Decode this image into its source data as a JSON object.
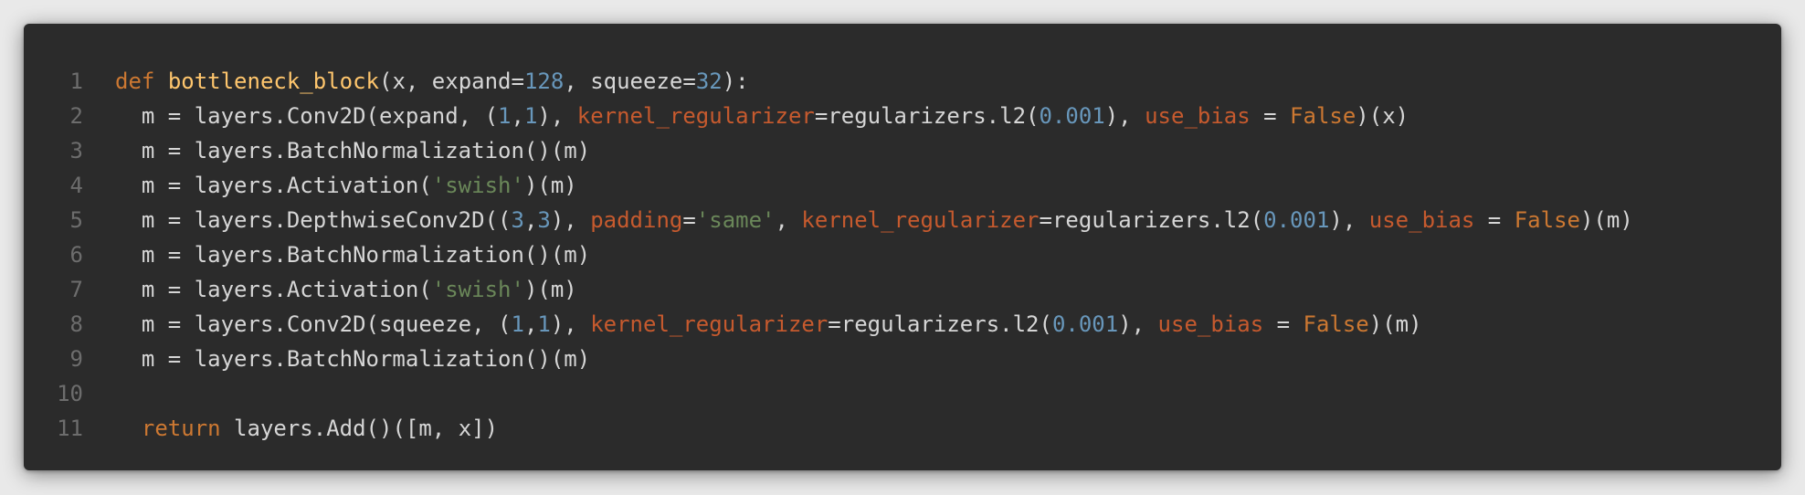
{
  "colors": {
    "background": "#2b2b2b",
    "page": "#e9e9e9",
    "line_number": "#6d6d6d",
    "plain": "#d6d6d6",
    "keyword": "#cc7832",
    "function_name": "#ffc66d",
    "number": "#6897bb",
    "string": "#6a8759",
    "keyword_argument": "#c65a2e"
  },
  "lines": [
    {
      "number": "1",
      "tokens": [
        {
          "t": "def",
          "c": "kw"
        },
        {
          "t": " ",
          "c": "pl"
        },
        {
          "t": "bottleneck_block",
          "c": "fn"
        },
        {
          "t": "(x, expand=",
          "c": "pl"
        },
        {
          "t": "128",
          "c": "num"
        },
        {
          "t": ", squeeze=",
          "c": "pl"
        },
        {
          "t": "32",
          "c": "num"
        },
        {
          "t": "):",
          "c": "pl"
        }
      ]
    },
    {
      "number": "2",
      "tokens": [
        {
          "t": "  m = layers.Conv2D(expand, (",
          "c": "pl"
        },
        {
          "t": "1",
          "c": "num"
        },
        {
          "t": ",",
          "c": "pl"
        },
        {
          "t": "1",
          "c": "num"
        },
        {
          "t": "), ",
          "c": "pl"
        },
        {
          "t": "kernel_regularizer",
          "c": "kwa"
        },
        {
          "t": "=regularizers.l2(",
          "c": "pl"
        },
        {
          "t": "0.001",
          "c": "num"
        },
        {
          "t": "), ",
          "c": "pl"
        },
        {
          "t": "use_bias",
          "c": "kwa"
        },
        {
          "t": " = ",
          "c": "pl"
        },
        {
          "t": "False",
          "c": "kw"
        },
        {
          "t": ")(x)",
          "c": "pl"
        }
      ]
    },
    {
      "number": "3",
      "tokens": [
        {
          "t": "  m = layers.BatchNormalization()(m)",
          "c": "pl"
        }
      ]
    },
    {
      "number": "4",
      "tokens": [
        {
          "t": "  m = layers.Activation(",
          "c": "pl"
        },
        {
          "t": "'swish'",
          "c": "str"
        },
        {
          "t": ")(m)",
          "c": "pl"
        }
      ]
    },
    {
      "number": "5",
      "tokens": [
        {
          "t": "  m = layers.DepthwiseConv2D((",
          "c": "pl"
        },
        {
          "t": "3",
          "c": "num"
        },
        {
          "t": ",",
          "c": "pl"
        },
        {
          "t": "3",
          "c": "num"
        },
        {
          "t": "), ",
          "c": "pl"
        },
        {
          "t": "padding",
          "c": "kwa"
        },
        {
          "t": "=",
          "c": "pl"
        },
        {
          "t": "'same'",
          "c": "str"
        },
        {
          "t": ", ",
          "c": "pl"
        },
        {
          "t": "kernel_regularizer",
          "c": "kwa"
        },
        {
          "t": "=regularizers.l2(",
          "c": "pl"
        },
        {
          "t": "0.001",
          "c": "num"
        },
        {
          "t": "), ",
          "c": "pl"
        },
        {
          "t": "use_bias",
          "c": "kwa"
        },
        {
          "t": " = ",
          "c": "pl"
        },
        {
          "t": "False",
          "c": "kw"
        },
        {
          "t": ")(m)",
          "c": "pl"
        }
      ]
    },
    {
      "number": "6",
      "tokens": [
        {
          "t": "  m = layers.BatchNormalization()(m)",
          "c": "pl"
        }
      ]
    },
    {
      "number": "7",
      "tokens": [
        {
          "t": "  m = layers.Activation(",
          "c": "pl"
        },
        {
          "t": "'swish'",
          "c": "str"
        },
        {
          "t": ")(m)",
          "c": "pl"
        }
      ]
    },
    {
      "number": "8",
      "tokens": [
        {
          "t": "  m = layers.Conv2D(squeeze, (",
          "c": "pl"
        },
        {
          "t": "1",
          "c": "num"
        },
        {
          "t": ",",
          "c": "pl"
        },
        {
          "t": "1",
          "c": "num"
        },
        {
          "t": "), ",
          "c": "pl"
        },
        {
          "t": "kernel_regularizer",
          "c": "kwa"
        },
        {
          "t": "=regularizers.l2(",
          "c": "pl"
        },
        {
          "t": "0.001",
          "c": "num"
        },
        {
          "t": "), ",
          "c": "pl"
        },
        {
          "t": "use_bias",
          "c": "kwa"
        },
        {
          "t": " = ",
          "c": "pl"
        },
        {
          "t": "False",
          "c": "kw"
        },
        {
          "t": ")(m)",
          "c": "pl"
        }
      ]
    },
    {
      "number": "9",
      "tokens": [
        {
          "t": "  m = layers.BatchNormalization()(m)",
          "c": "pl"
        }
      ]
    },
    {
      "number": "10",
      "tokens": []
    },
    {
      "number": "11",
      "tokens": [
        {
          "t": "  ",
          "c": "pl"
        },
        {
          "t": "return",
          "c": "kw"
        },
        {
          "t": " layers.Add()([m, x])",
          "c": "pl"
        }
      ]
    }
  ]
}
